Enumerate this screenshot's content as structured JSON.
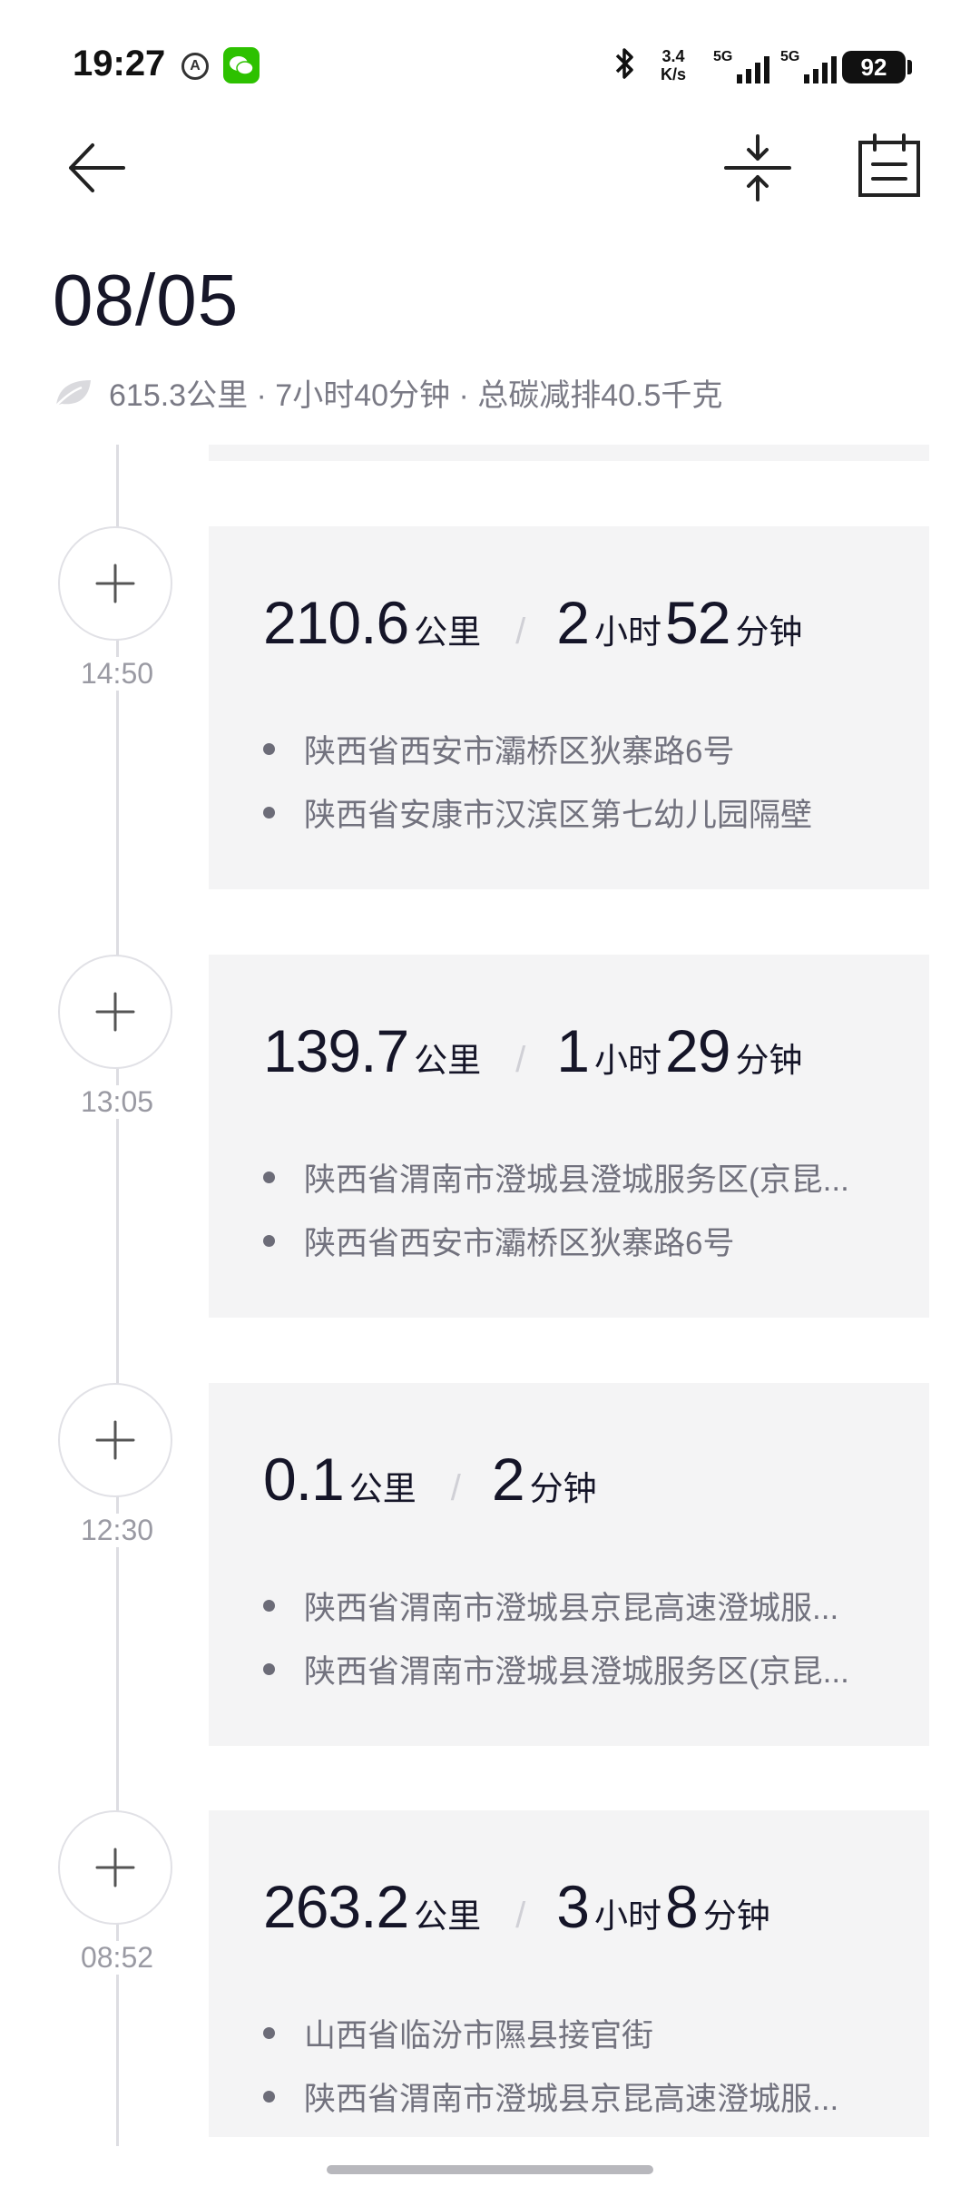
{
  "status_bar": {
    "time": "19:27",
    "net_speed_top": "3.4",
    "net_speed_bottom": "K/s",
    "signal_1": "5G",
    "signal_2": "5G",
    "battery": "92",
    "icons": [
      "accessibility-icon",
      "wechat-icon",
      "bluetooth-icon",
      "signal-icon",
      "battery-icon"
    ]
  },
  "toolbar": {
    "back_icon": "arrow-left-icon",
    "collapse_icon": "collapse-icon",
    "calendar_icon": "calendar-icon"
  },
  "header": {
    "date": "08/05",
    "summary": "615.3公里 · 7小时40分钟 · 总碳减排40.5千克",
    "summary_icon": "leaf-icon"
  },
  "trips": [
    {
      "time": "14:50",
      "distance": "210.6",
      "distance_unit": "公里",
      "hours": "2",
      "hours_unit": "小时",
      "minutes": "52",
      "minutes_unit": "分钟",
      "start": "陕西省西安市灞桥区狄寨路6号",
      "end": "陕西省安康市汉滨区第七幼儿园隔壁"
    },
    {
      "time": "13:05",
      "distance": "139.7",
      "distance_unit": "公里",
      "hours": "1",
      "hours_unit": "小时",
      "minutes": "29",
      "minutes_unit": "分钟",
      "start": "陕西省渭南市澄城县澄城服务区(京昆...",
      "end": "陕西省西安市灞桥区狄寨路6号"
    },
    {
      "time": "12:30",
      "distance": "0.1",
      "distance_unit": "公里",
      "minutes": "2",
      "minutes_unit": "分钟",
      "start": "陕西省渭南市澄城县京昆高速澄城服...",
      "end": "陕西省渭南市澄城县澄城服务区(京昆..."
    },
    {
      "time": "08:52",
      "distance": "263.2",
      "distance_unit": "公里",
      "hours": "3",
      "hours_unit": "小时",
      "minutes": "8",
      "minutes_unit": "分钟",
      "start": "山西省临汾市隰县接官街",
      "end": "陕西省渭南市澄城县京昆高速澄城服..."
    }
  ],
  "colors": {
    "card_bg": "#f4f4f5",
    "text_primary": "#151528",
    "text_secondary": "#72727e",
    "timeline": "#dddde2"
  }
}
